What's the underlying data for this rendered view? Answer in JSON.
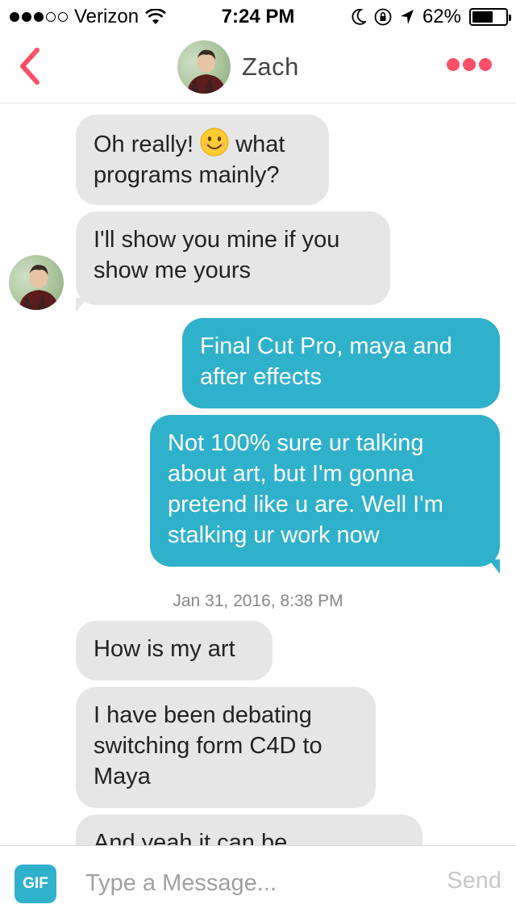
{
  "status_bar": {
    "carrier": "Verizon",
    "time": "7:24 PM",
    "battery_percent": "62%",
    "battery_level": 0.62,
    "signal_bars": 3,
    "signal_max": 5,
    "icons": [
      "wifi-icon",
      "moon-icon",
      "rotation-lock-icon",
      "location-arrow-icon",
      "battery-icon"
    ]
  },
  "header": {
    "contact_name": "Zach",
    "back_icon": "chevron-left-icon",
    "more_icon": "more-dots-icon",
    "accent_color": "#fd5068"
  },
  "messages": [
    {
      "direction": "in",
      "text_before": "Oh really! ",
      "emoji": "smiling-face-icon",
      "text_after": " what\nprograms mainly?"
    },
    {
      "direction": "in",
      "text": "I'll show you mine if you\nshow me yours",
      "show_avatar": true
    },
    {
      "direction": "out",
      "text": "Final Cut Pro, maya and\nafter effects"
    },
    {
      "direction": "out",
      "text": "Not 100% sure ur talking\nabout art, but I'm gonna\npretend like u are. Well I'm\nstalking ur work now"
    },
    {
      "timestamp": "Jan 31, 2016, 8:38 PM"
    },
    {
      "direction": "in",
      "text": "How is my art"
    },
    {
      "direction": "in",
      "text": "I have been debating\nswitching form C4D to\nMaya"
    },
    {
      "direction": "in",
      "text": "And yeah it can be"
    }
  ],
  "composer": {
    "gif_label": "GIF",
    "placeholder": "Type a Message...",
    "send_label": "Send",
    "accent_color": "#30b1cb"
  }
}
